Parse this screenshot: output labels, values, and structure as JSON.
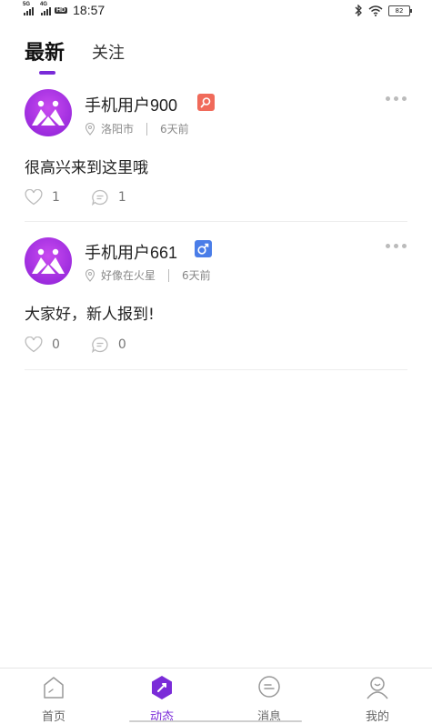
{
  "status_bar": {
    "net1": "5G",
    "net2": "4G",
    "hd": "HD",
    "time": "18:57",
    "battery": "82"
  },
  "tabs": {
    "latest": "最新",
    "follow": "关注"
  },
  "posts": [
    {
      "username": "手机用户900",
      "badge_icon": "search-icon",
      "badge_color": "#f06a5a",
      "location": "洛阳市",
      "time": "6天前",
      "content": "很高兴来到这里哦",
      "likes": "1",
      "comments": "1"
    },
    {
      "username": "手机用户661",
      "badge_icon": "male-icon",
      "badge_color": "#4a7de8",
      "location": "好像在火星",
      "time": "6天前",
      "content": "大家好，新人报到!",
      "likes": "0",
      "comments": "0"
    }
  ],
  "nav": {
    "home": "首页",
    "feed": "动态",
    "messages": "消息",
    "mine": "我的"
  },
  "colors": {
    "accent": "#7a2bd8",
    "avatar": "#b23fe8"
  }
}
